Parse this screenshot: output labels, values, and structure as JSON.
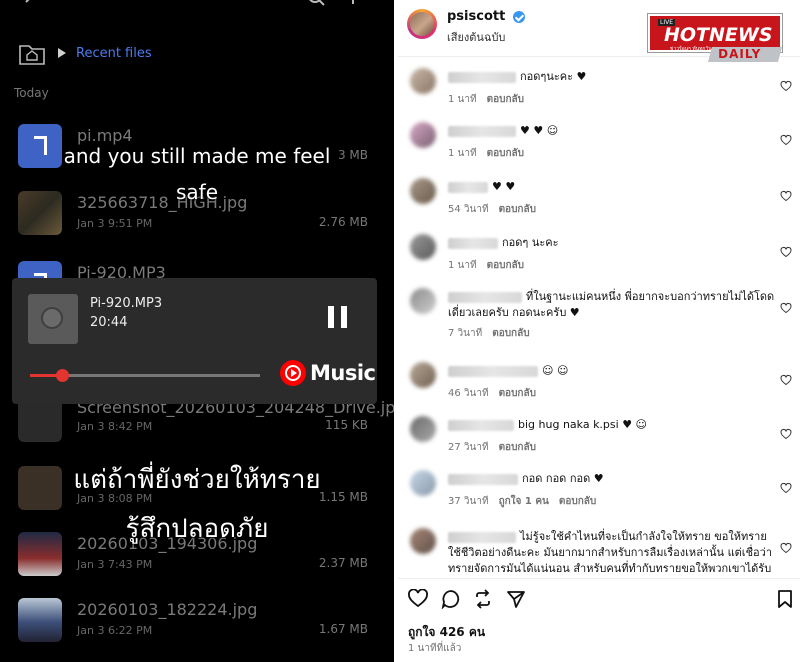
{
  "left": {
    "breadcrumb": {
      "label": "Recent files"
    },
    "section_label": "Today",
    "files": [
      {
        "name": "pi.mp4",
        "meta": "",
        "size": "3 MB",
        "thumb": "audio"
      },
      {
        "name": "325663718_HIGH.jpg",
        "meta": "Jan 3 9:51 PM",
        "size": "2.76 MB",
        "thumb": "img"
      },
      {
        "name": "Pi-920.MP3",
        "meta": "",
        "size": "",
        "thumb": "audio"
      },
      {
        "name": "Screenshot_20260103_204248_Drive.jpg",
        "meta": "Jan 3 8:42 PM",
        "size": "115 KB",
        "thumb": "img"
      },
      {
        "name": "",
        "meta": "Jan 3 8:08 PM",
        "size": "1.15 MB",
        "thumb": "img"
      },
      {
        "name": "20260103_194306.jpg",
        "meta": "Jan 3 7:43 PM",
        "size": "2.37 MB",
        "thumb": "img2"
      },
      {
        "name": "20260103_182224.jpg",
        "meta": "Jan 3 6:22 PM",
        "size": "1.67 MB",
        "thumb": "img3"
      }
    ],
    "player": {
      "title": "Pi-920.MP3",
      "time": "20:44",
      "progress": 0.14,
      "brand": "Music"
    },
    "subtitles": {
      "line1": "and you still made me feel",
      "line2": "safe",
      "line3": "แต่ถ้าพี่ยังช่วยให้ทราย",
      "line4": "รู้สึกปลอดภัย"
    }
  },
  "right": {
    "header": {
      "username": "psiscott",
      "subtitle": "เสียงต้นฉบับ"
    },
    "logo": {
      "main": "HOTNEWS",
      "sub": "DAILY",
      "live": "LIVE",
      "tag": "ข่าวร้อนๆ ทันทุกวัน"
    },
    "comments": [
      {
        "text": "กอดๆนะคะ ♥",
        "meta": "1 นาที",
        "reply": "ตอบกลับ",
        "name_w": 68
      },
      {
        "text": "♥ ♥ ☺",
        "meta": "1 นาที",
        "reply": "ตอบกลับ",
        "name_w": 68
      },
      {
        "text": "♥ ♥",
        "meta": "54 วินาที",
        "reply": "ตอบกลับ",
        "name_w": 40
      },
      {
        "text": "กอดๆ นะคะ",
        "meta": "1 นาที",
        "reply": "ตอบกลับ",
        "name_w": 50
      },
      {
        "text": "ที่ในฐานะแม่คนหนึ่ง พี่อยากจะบอกว่าทรายไม่ได้โดดเดี่ยวเลยครับ กอดนะครับ ♥",
        "meta": "7 วินาที",
        "reply": "ตอบกลับ",
        "name_w": 74
      },
      {
        "text": "☺ ☺",
        "meta": "46 วินาที",
        "reply": "ตอบกลับ",
        "name_w": 90
      },
      {
        "text": "big hug naka k.psi ♥ ☺",
        "meta": "27 วินาที",
        "reply": "ตอบกลับ",
        "name_w": 66
      },
      {
        "text": "กอด กอด กอด ♥",
        "meta": "37 วินาที",
        "likes": "ถูกใจ 1 คน",
        "reply": "ตอบกลับ",
        "name_w": 70
      },
      {
        "text": "ไม่รู้จะใช้คำไหนที่จะเป็นกำลังใจให้ทราย ขอให้ทรายใช้ชีวิตอย่างดีนะคะ มันยากมากสำหรับการลืมเรื่องเหล่านั้น แต่เชื่อว่าทรายจัดการมันได้แน่นอน สำหรับคนที่ทำกับทรายขอให้พวกเขาได้รับ",
        "meta": "",
        "reply": "",
        "name_w": 68
      }
    ],
    "footer": {
      "likes": "ถูกใจ 426 คน",
      "posted": "1 นาทีที่แล้ว"
    }
  },
  "colors": {
    "accent": "#4a7cf0",
    "red": "#e3342f",
    "ig_blue": "#3897f0",
    "heart": "#e0245e"
  },
  "icons": [
    "back-arrow-icon",
    "search-icon",
    "more-icon",
    "folder-home-icon",
    "pause-icon",
    "youtube-music-icon",
    "verified-icon",
    "heart-icon",
    "comment-icon",
    "repost-icon",
    "share-icon",
    "bookmark-icon"
  ]
}
